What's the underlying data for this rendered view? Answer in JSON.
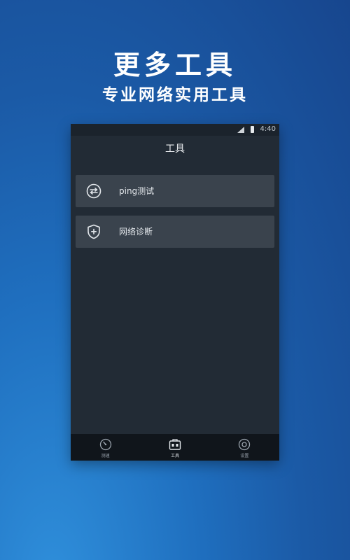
{
  "promo": {
    "title": "更多工具",
    "subtitle": "专业网络实用工具"
  },
  "status_bar": {
    "time": "4:40"
  },
  "header": {
    "title": "工具"
  },
  "tools": [
    {
      "label": "ping测试",
      "icon": "ping-swap-icon"
    },
    {
      "label": "网络诊断",
      "icon": "shield-plus-icon"
    }
  ],
  "bottom_nav": [
    {
      "label": "测速",
      "icon": "speedometer-icon",
      "active": false
    },
    {
      "label": "工具",
      "icon": "toolbox-icon",
      "active": true
    },
    {
      "label": "设置",
      "icon": "gear-icon",
      "active": false
    }
  ],
  "colors": {
    "background_top": "#17468e",
    "background_bottom": "#2f8fdb",
    "phone_bg": "#222b35",
    "item_bg": "#3a434d",
    "nav_bg": "#10151b"
  }
}
